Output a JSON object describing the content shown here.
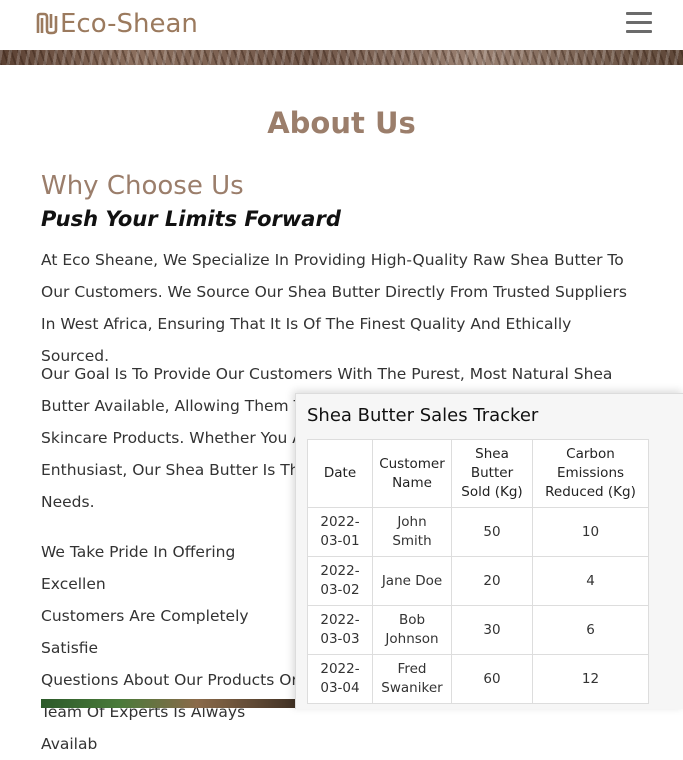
{
  "header": {
    "logo_text": "Eco-Shean",
    "logo_icon": "eco-shean-logo-mark",
    "menu_icon": "hamburger-menu-icon",
    "brand_color": "#9b7a5e"
  },
  "about": {
    "title": "About Us",
    "why_title": "Why Choose Us",
    "subtitle": "Push Your Limits Forward",
    "paragraphs": [
      "At Eco Sheane, We Specialize In Providing High-Quality Raw Shea Butter To Our Customers. We Source Our Shea Butter Directly From Trusted Suppliers In West Africa, Ensuring That It Is Of The Finest Quality And Ethically Sourced.",
      "Our Goal Is To Provide Our Customers With The Purest, Most Natural Shea Butter Available, Allowing Them To Skincare Products. Whether You A Enthusiast, Our Shea Butter Is The Needs.",
      "We Take Pride In Offering Excellen Customers Are Completely Satisfie Questions About Our Products Or Team Of Experts Is Always Availab"
    ]
  },
  "tracker": {
    "title": "Shea Butter Sales Tracker",
    "columns": [
      "Date",
      "Customer Name",
      "Shea Butter Sold (Kg)",
      "Carbon Emissions Reduced (Kg)"
    ],
    "rows": [
      {
        "date": "2022-03-01",
        "customer": "John Smith",
        "sold": "50",
        "carbon": "10"
      },
      {
        "date": "2022-03-02",
        "customer": "Jane Doe",
        "sold": "20",
        "carbon": "4"
      },
      {
        "date": "2022-03-03",
        "customer": "Bob Johnson",
        "sold": "30",
        "carbon": "6"
      },
      {
        "date": "2022-03-04",
        "customer": "Fred Swaniker",
        "sold": "60",
        "carbon": "12"
      }
    ]
  }
}
